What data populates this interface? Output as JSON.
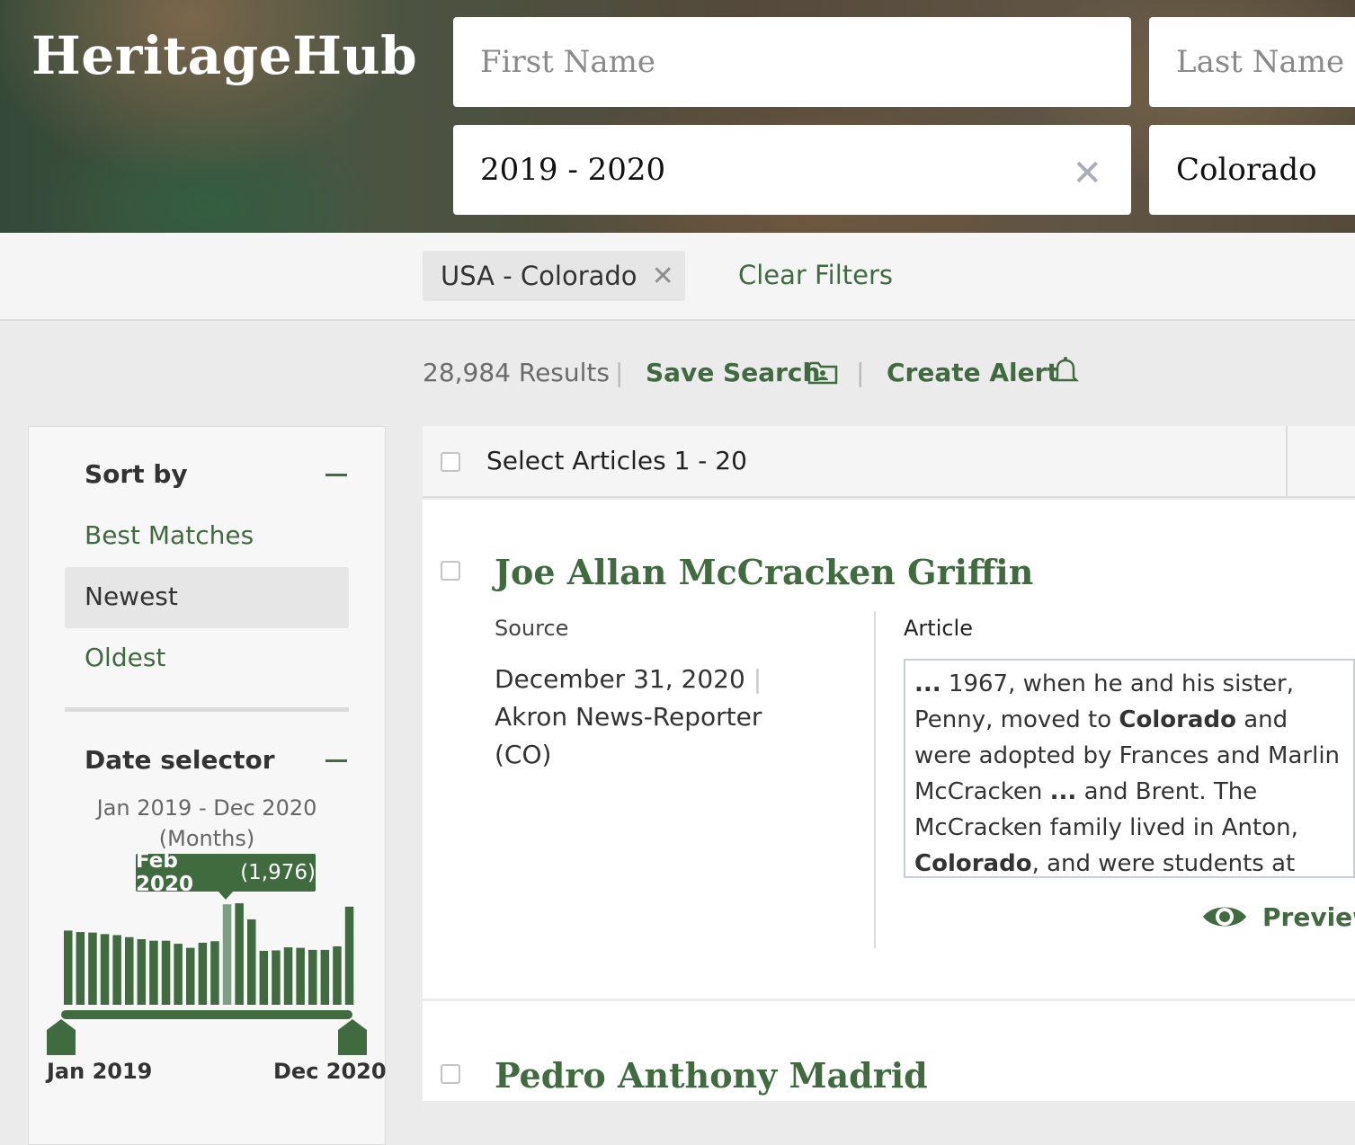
{
  "header": {
    "logo": "HeritageHub",
    "first_name_placeholder": "First Name",
    "last_name_placeholder": "Last Name",
    "date_value": "2019 - 2020",
    "location_value": "Colorado"
  },
  "filters": {
    "active_chip": "USA - Colorado",
    "clear_label": "Clear Filters"
  },
  "results_bar": {
    "count": "28,984 Results",
    "save_search": "Save Search",
    "create_alert": "Create Alert"
  },
  "sidebar": {
    "sort_heading": "Sort by",
    "sort_options": [
      "Best Matches",
      "Newest",
      "Oldest"
    ],
    "selected_sort": "Newest",
    "date_heading": "Date selector",
    "date_range_line1": "Jan 2019 - Dec 2020",
    "date_range_line2": "(Months)",
    "tooltip_month": "Feb 2020",
    "tooltip_count": "(1,976)",
    "axis_start": "Jan 2019",
    "axis_end": "Dec 2020"
  },
  "chart_data": {
    "type": "bar",
    "categories": [
      "Jan 2019",
      "Feb 2019",
      "Mar 2019",
      "Apr 2019",
      "May 2019",
      "Jun 2019",
      "Jul 2019",
      "Aug 2019",
      "Sep 2019",
      "Oct 2019",
      "Nov 2019",
      "Dec 2019",
      "Jan 2020",
      "Feb 2020",
      "Mar 2020",
      "Apr 2020",
      "May 2020",
      "Jun 2020",
      "Jul 2020",
      "Aug 2020",
      "Sep 2020",
      "Oct 2020",
      "Nov 2020",
      "Dec 2020"
    ],
    "values": [
      1460,
      1430,
      1420,
      1390,
      1370,
      1330,
      1290,
      1260,
      1260,
      1200,
      1120,
      1220,
      1250,
      1976,
      1996,
      1680,
      1060,
      1070,
      1130,
      1120,
      1080,
      1080,
      1150,
      1930
    ],
    "highlight_index": 13,
    "colors": {
      "bar": "#3f6b3f",
      "highlight": "#7f9e84"
    }
  },
  "results": {
    "select_label": "Select Articles 1 - 20",
    "items": [
      {
        "title": "Joe Allan McCracken Griffin",
        "source_label": "Source",
        "date": "December 31, 2020",
        "source": "Akron News-Reporter (CO)",
        "article_label": "Article",
        "excerpt_html": "<b>...</b> 1967, when he and his sister, Penny, moved to <b>Colorado</b> and were adopted by Frances and Marlin McCracken <b>...</b> and Brent. The McCracken family lived in Anton, <b>Colorado</b>, and were students at Arickaree School. Joe <b>...</b>",
        "preview_label": "Preview"
      },
      {
        "title": "Pedro Anthony Madrid"
      }
    ]
  },
  "theme": {
    "accent": "#3f6b3f"
  }
}
